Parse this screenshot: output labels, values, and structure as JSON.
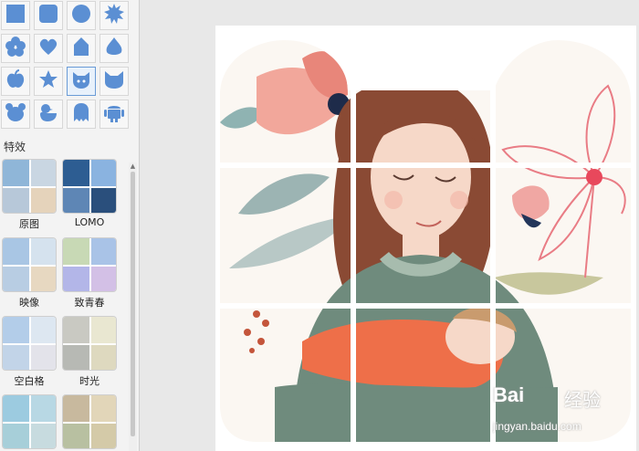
{
  "left_panel": {
    "shapes": [
      {
        "icon": "square-icon"
      },
      {
        "icon": "rounded-square-icon"
      },
      {
        "icon": "circle-icon"
      },
      {
        "icon": "burst-icon"
      },
      {
        "icon": "flower-icon"
      },
      {
        "icon": "heart-icon"
      },
      {
        "icon": "tag-icon"
      },
      {
        "icon": "drop-icon"
      },
      {
        "icon": "apple-icon"
      },
      {
        "icon": "star-icon"
      },
      {
        "icon": "cat-icon",
        "selected": true
      },
      {
        "icon": "cat-head-icon"
      },
      {
        "icon": "bear-icon"
      },
      {
        "icon": "duck-icon"
      },
      {
        "icon": "ghost-icon"
      },
      {
        "icon": "android-icon"
      }
    ],
    "section_title": "特效",
    "effects": [
      {
        "label": "原图",
        "palette": [
          "#8fb6d8",
          "#c9d6e2",
          "#b7c8d9",
          "#e5d3bb"
        ]
      },
      {
        "label": "LOMO",
        "palette": [
          "#2d5d92",
          "#8ab3e0",
          "#5e86b5",
          "#2a4f7c"
        ]
      },
      {
        "label": "映像",
        "palette": [
          "#a9c6e4",
          "#d5e2ee",
          "#b8cde3",
          "#e7d8c1"
        ]
      },
      {
        "label": "致青春",
        "palette": [
          "#c8d9b5",
          "#a9c3e7",
          "#b3b6e8",
          "#d3c0e6"
        ]
      },
      {
        "label": "空白格",
        "palette": [
          "#b3cde9",
          "#dde7f1",
          "#c2d4e8",
          "#e3e3ea"
        ]
      },
      {
        "label": "时光",
        "palette": [
          "#c9c9c2",
          "#e9e7d1",
          "#b7b9b4",
          "#ded9bf"
        ]
      },
      {
        "label": "",
        "palette": [
          "#9ccbe0",
          "#b8d8e4",
          "#a7cfd9",
          "#c7dbdf"
        ]
      },
      {
        "label": "",
        "palette": [
          "#c8b99e",
          "#e2d6b9",
          "#b8c0a1",
          "#d4caa8"
        ]
      }
    ]
  },
  "watermark": {
    "brand": "Bai",
    "brand_suffix": "经验",
    "url": "jingyan.baidu.com"
  },
  "colors": {
    "accent": "#5b8fd3",
    "panel_bg": "#f3f3f3"
  }
}
